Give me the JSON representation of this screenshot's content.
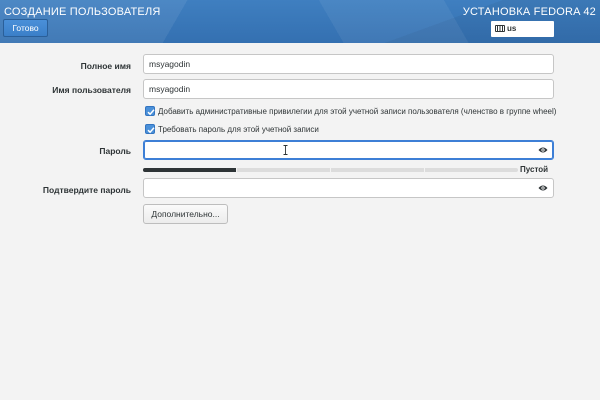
{
  "header": {
    "title": "СОЗДАНИЕ ПОЛЬЗОВАТЕЛЯ",
    "done_label": "Готово",
    "install_title": "УСТАНОВКА FEDORA 42",
    "keyboard_layout": "us",
    "background_color": "#3a78b9"
  },
  "form": {
    "full_name": {
      "label": "Полное имя",
      "value": "msyagodin"
    },
    "username": {
      "label": "Имя пользователя",
      "value": "msyagodin"
    },
    "admin_checkbox": {
      "label": "Добавить административные привилегии для этой учетной записи пользователя (членство в группе wheel)",
      "checked": true
    },
    "require_password_checkbox": {
      "label": "Требовать пароль для этой учетной записи",
      "checked": true
    },
    "password": {
      "label": "Пароль",
      "value": ""
    },
    "password_strength": {
      "label": "Пустой",
      "level": 0.25
    },
    "confirm_password": {
      "label": "Подтвердите пароль",
      "value": ""
    },
    "advanced_label": "Дополнительно..."
  },
  "colors": {
    "accent": "#4a90d9",
    "focus_border": "#3d7fd6",
    "strength_fill": "#2e3436"
  }
}
